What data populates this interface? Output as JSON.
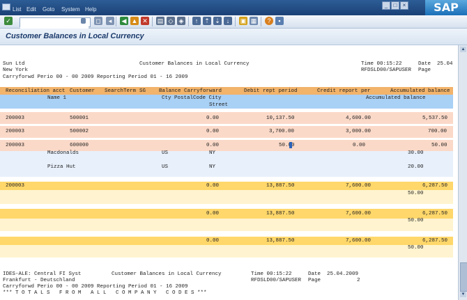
{
  "menu": {
    "items": [
      "List",
      "Edit",
      "Goto",
      "System",
      "Help"
    ]
  },
  "brand": "SAP",
  "window_buttons": [
    "_",
    "□",
    "×"
  ],
  "title": "Customer Balances in Local Currency",
  "toolbar_icons": [
    "enter-icon",
    "command-field",
    "save-icon",
    "back-icon",
    "exit-icon",
    "cancel-icon",
    "print-icon",
    "find-icon",
    "find-next-icon",
    "first-page-icon",
    "previous-page-icon",
    "next-page-icon",
    "last-page-icon",
    "create-session-icon",
    "create-shortcut-icon",
    "help-icon",
    "customize-icon"
  ],
  "report": {
    "company": "Sun Ltd",
    "city": "New York",
    "header_title": "Customer Balances in Local Currency",
    "time": "Time 00:15:22",
    "date": "Date  25.04",
    "report_id": "RFDSLD00/SAPUSER",
    "page": "Page",
    "carryforward": "Carryforwd Perio 00 - 00 2009 Reporting Period 01 - 16 2009",
    "columns": {
      "reconciliation": "Reconciliation acct",
      "customer": "Customer",
      "searchterm": "SearchTerm",
      "sg": "SG",
      "balance_cf": "Balance Carryforward",
      "debit": "Debit rept period",
      "credit": "Credit report per",
      "accumulated": "Accumulated balance",
      "name1": "Name 1",
      "cty_postal_city": "Cty PostalCode City",
      "accumulated2": "Accumulated balance",
      "street": "Street"
    },
    "rows": [
      {
        "recon": "200003",
        "customer": "500001",
        "balance": "0.00",
        "debit": "10,137.50",
        "credit": "4,600.00",
        "accum": "5,537.50"
      },
      {
        "recon": "200003",
        "customer": "500002",
        "balance": "0.00",
        "debit": "3,700.00",
        "credit": "3,000.00",
        "accum": "700.00"
      },
      {
        "recon": "200003",
        "customer": "600000",
        "balance": "0.00",
        "debit": "50.00",
        "credit": "0.00",
        "accum": "50.00"
      }
    ],
    "cursor_text": "50 00",
    "sub_rows": [
      {
        "name": "Macdonalds",
        "country": "US",
        "region": "NY",
        "value": "30.00"
      },
      {
        "name": "Pizza Hut",
        "country": "US",
        "region": "NY",
        "value": "20.00"
      }
    ],
    "totals": [
      {
        "recon": "200003",
        "balance": "0.00",
        "debit": "13,887.50",
        "credit": "7,600.00",
        "accum": "6,287.50",
        "accum2": "50.00"
      },
      {
        "recon": "",
        "balance": "0.00",
        "debit": "13,887.50",
        "credit": "7,600.00",
        "accum": "6,287.50",
        "accum2": "50.00"
      },
      {
        "recon": "",
        "balance": "0.00",
        "debit": "13,887.50",
        "credit": "7,600.00",
        "accum": "6,287.50",
        "accum2": "50.00"
      }
    ],
    "footer": {
      "company": "IDES-ALE: Central FI Syst",
      "city": "Frankfurt - Deutschland",
      "header_title": "Customer Balances in Local Currency",
      "time": "Time 00:15:22",
      "date": "Date  25.04.2009",
      "report_id": "RFDSLD00/SAPUSER",
      "page": "Page",
      "page_no": "2",
      "carryforward": "Carryforwd Perio 00 - 00 2009 Reporting Period 01 - 16 2009",
      "totals_line": "*** T O T A L S   F R O M   A L L   C O M P A N Y   C O D E S ***"
    }
  },
  "colors": {
    "header_band": "#f2b36a",
    "subheader_band": "#a9d0f5",
    "row_band": "#fbd9c8",
    "sub_row_band": "#e8f0fb",
    "total_band": "#ffd76a",
    "total_sub_band": "#fff4cf"
  }
}
